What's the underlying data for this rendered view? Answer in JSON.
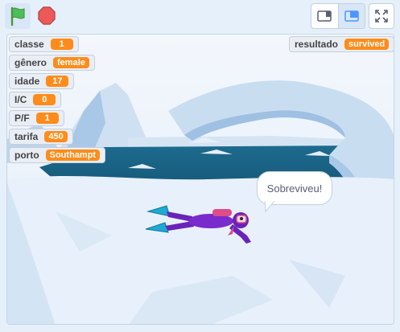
{
  "toolbar": {
    "green_flag": "green-flag-icon",
    "stop": "stop-icon",
    "small_stage": "small-stage-icon",
    "normal_stage": "normal-stage-icon",
    "fullscreen": "fullscreen-icon"
  },
  "monitors": [
    {
      "label": "classe",
      "value": "1"
    },
    {
      "label": "gênero",
      "value": "female"
    },
    {
      "label": "idade",
      "value": "17"
    },
    {
      "label": "I/C",
      "value": "0"
    },
    {
      "label": "P/F",
      "value": "1"
    },
    {
      "label": "tarifa",
      "value": "450"
    },
    {
      "label": "porto",
      "value": "Southampt"
    }
  ],
  "result_monitor": {
    "label": "resultado",
    "value": "survived"
  },
  "speech_bubble": "Sobreviveu!",
  "colors": {
    "accent": "#ff8c1a",
    "flag": "#4cbf56",
    "stop": "#ec5959"
  }
}
